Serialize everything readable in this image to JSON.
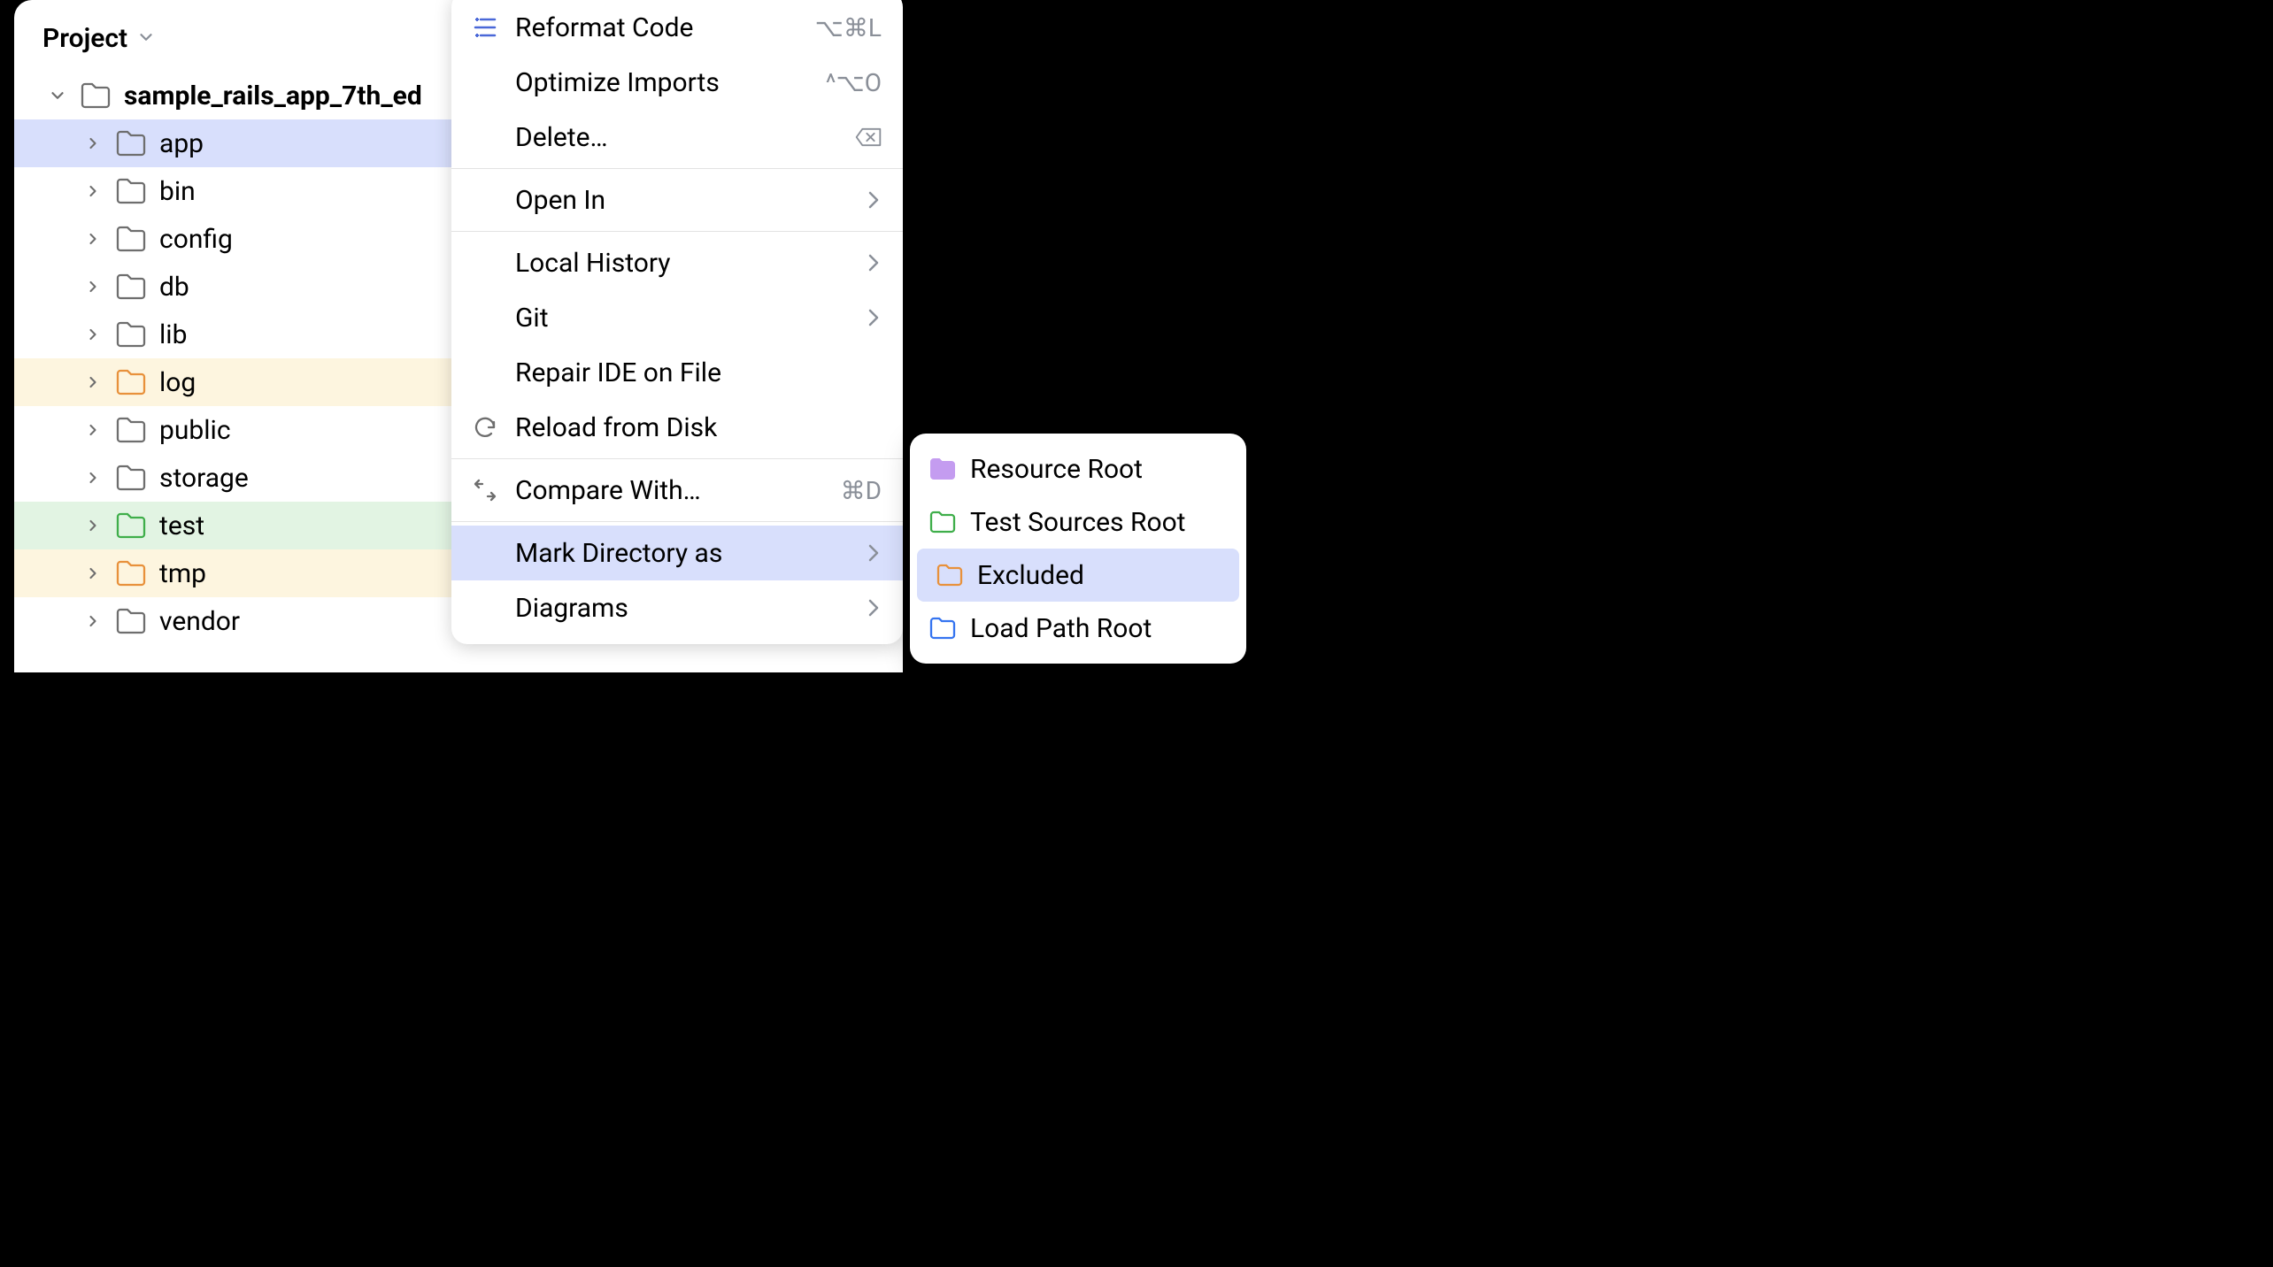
{
  "panel": {
    "title": "Project"
  },
  "tree": {
    "root": "sample_rails_app_7th_ed",
    "items": [
      {
        "label": "app",
        "bg": "selected",
        "folderColor": "#6e6e6e"
      },
      {
        "label": "bin",
        "bg": "",
        "folderColor": "#6e6e6e"
      },
      {
        "label": "config",
        "bg": "",
        "folderColor": "#6e6e6e"
      },
      {
        "label": "db",
        "bg": "",
        "folderColor": "#6e6e6e"
      },
      {
        "label": "lib",
        "bg": "",
        "folderColor": "#6e6e6e"
      },
      {
        "label": "log",
        "bg": "orange",
        "folderColor": "#e8913b"
      },
      {
        "label": "public",
        "bg": "",
        "folderColor": "#6e6e6e"
      },
      {
        "label": "storage",
        "bg": "",
        "folderColor": "#6e6e6e"
      },
      {
        "label": "test",
        "bg": "green",
        "folderColor": "#3fae4a"
      },
      {
        "label": "tmp",
        "bg": "orange",
        "folderColor": "#e8913b"
      },
      {
        "label": "vendor",
        "bg": "",
        "folderColor": "#6e6e6e"
      }
    ]
  },
  "menu": {
    "reformat": {
      "label": "Reformat Code",
      "shortcut": "⌥⌘L"
    },
    "optimize": {
      "label": "Optimize Imports",
      "shortcut": "^⌥O"
    },
    "delete": {
      "label": "Delete…"
    },
    "open_in": {
      "label": "Open In"
    },
    "local_hist": {
      "label": "Local History"
    },
    "git": {
      "label": "Git"
    },
    "repair": {
      "label": "Repair IDE on File"
    },
    "reload": {
      "label": "Reload from Disk"
    },
    "compare": {
      "label": "Compare With…",
      "shortcut": "⌘D"
    },
    "mark_dir": {
      "label": "Mark Directory as"
    },
    "diagrams": {
      "label": "Diagrams"
    }
  },
  "submenu": {
    "resource": {
      "label": "Resource Root",
      "color": "#c49cf0",
      "filled": true
    },
    "test_src": {
      "label": "Test Sources Root",
      "color": "#3fae4a",
      "filled": false
    },
    "excluded": {
      "label": "Excluded",
      "color": "#e8913b",
      "filled": false
    },
    "load_path": {
      "label": "Load Path Root",
      "color": "#3574f0",
      "filled": false
    }
  }
}
